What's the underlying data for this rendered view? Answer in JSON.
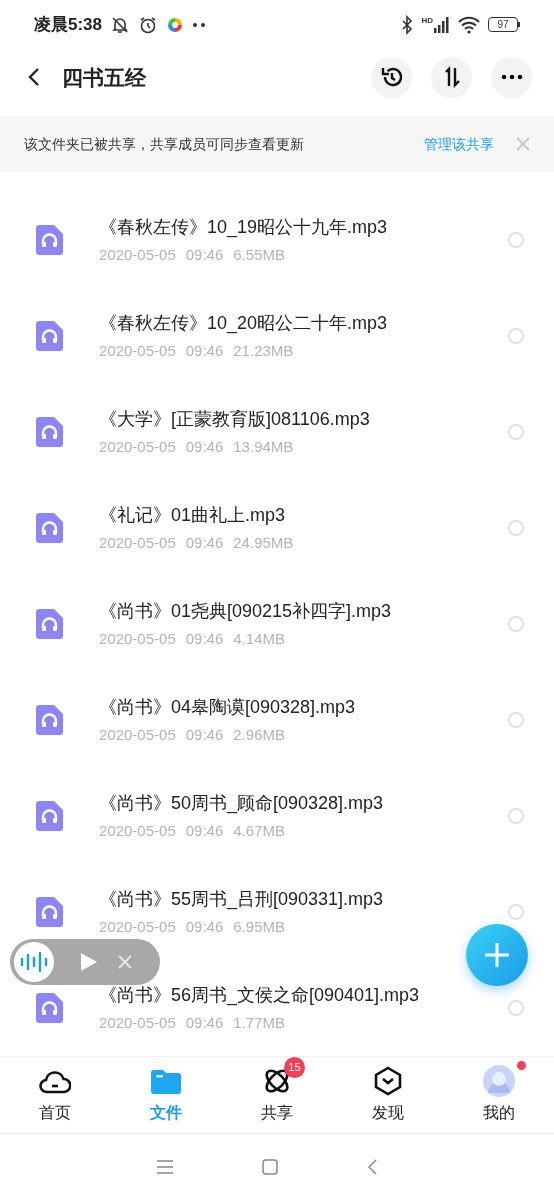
{
  "status_bar": {
    "time": "凌晨5:38",
    "network_label": "HD",
    "battery": "97"
  },
  "header": {
    "title": "四书五经"
  },
  "banner": {
    "message": "该文件夹已被共享，共享成员可同步查看更新",
    "link": "管理该共享"
  },
  "files": [
    {
      "name": "《春秋左传》10_19昭公十九年.mp3",
      "date": "2020-05-05",
      "time": "09:46",
      "size": "6.55MB",
      "selected": false
    },
    {
      "name": "《春秋左传》10_20昭公二十年.mp3",
      "date": "2020-05-05",
      "time": "09:46",
      "size": "21.23MB",
      "selected": false
    },
    {
      "name": "《大学》[正蒙教育版]081106.mp3",
      "date": "2020-05-05",
      "time": "09:46",
      "size": "13.94MB",
      "selected": false
    },
    {
      "name": "《礼记》01曲礼上.mp3",
      "date": "2020-05-05",
      "time": "09:46",
      "size": "24.95MB",
      "selected": false
    },
    {
      "name": "《尚书》01尧典[090215补四字].mp3",
      "date": "2020-05-05",
      "time": "09:46",
      "size": "4.14MB",
      "selected": false
    },
    {
      "name": "《尚书》04皋陶谟[090328].mp3",
      "date": "2020-05-05",
      "time": "09:46",
      "size": "2.96MB",
      "selected": false
    },
    {
      "name": "《尚书》50周书_顾命[090328].mp3",
      "date": "2020-05-05",
      "time": "09:46",
      "size": "4.67MB",
      "selected": false
    },
    {
      "name": "《尚书》55周书_吕刑[090331].mp3",
      "date": "2020-05-05",
      "time": "09:46",
      "size": "6.95MB",
      "selected": false
    },
    {
      "name": "《尚书》56周书_文侯之命[090401].mp3",
      "date": "2020-05-05",
      "time": "09:46",
      "size": "1.77MB",
      "selected": false
    }
  ],
  "nav": [
    {
      "kind": "home",
      "label": "首页",
      "selected": false
    },
    {
      "kind": "files",
      "label": "文件",
      "selected": true
    },
    {
      "kind": "share",
      "label": "共享",
      "selected": false,
      "badge": "15"
    },
    {
      "kind": "discover",
      "label": "发现",
      "selected": false
    },
    {
      "kind": "me",
      "label": "我的",
      "selected": false,
      "dot": true
    }
  ]
}
